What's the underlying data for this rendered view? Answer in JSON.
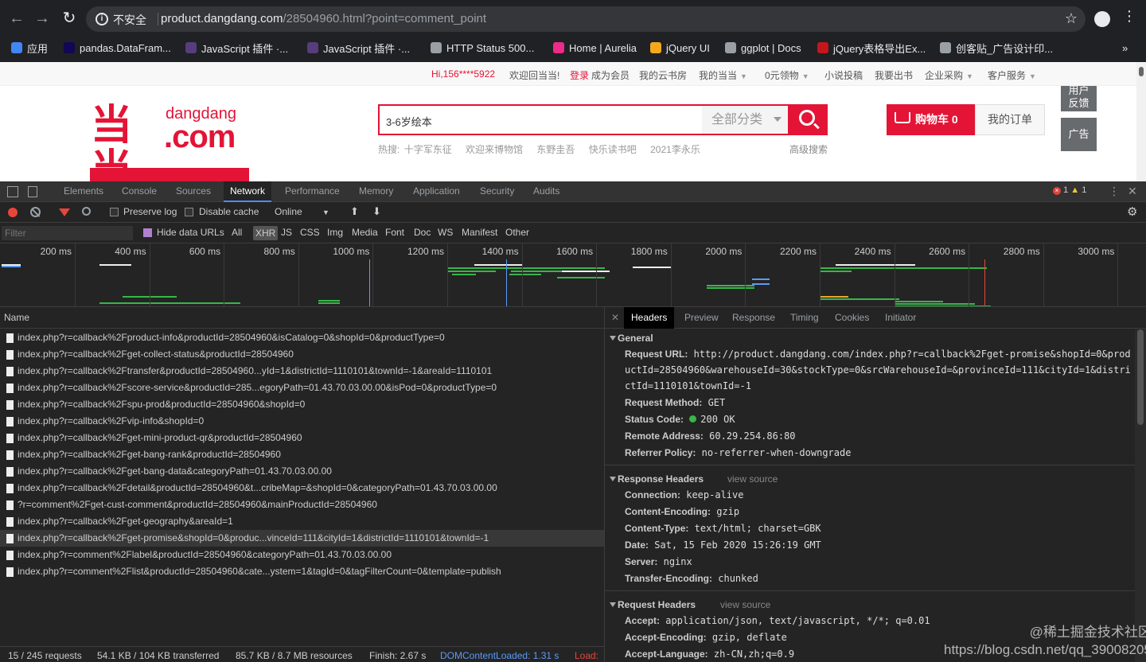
{
  "browser": {
    "insecure_label": "不安全",
    "url_host": "product.dangdang.com",
    "url_rest": "/28504960.html?point=comment_point",
    "bookmarks": [
      {
        "label": "应用",
        "icon": "apps-grid-icon",
        "color": "#4285f4"
      },
      {
        "label": "pandas.DataFram...",
        "icon": "pandas-icon",
        "color": "#130654"
      },
      {
        "label": "JavaScript 插件 ·...",
        "icon": "bootstrap-icon",
        "color": "#563d7c"
      },
      {
        "label": "JavaScript 插件 ·...",
        "icon": "bootstrap-icon",
        "color": "#563d7c"
      },
      {
        "label": "HTTP Status 500...",
        "icon": "globe-icon",
        "color": "#9aa0a6"
      },
      {
        "label": "Home | Aurelia",
        "icon": "aurelia-icon",
        "color": "#ed2b88"
      },
      {
        "label": "jQuery UI",
        "icon": "jquery-ui-icon",
        "color": "#f7a71c"
      },
      {
        "label": "ggplot | Docs",
        "icon": "globe-icon",
        "color": "#9aa0a6"
      },
      {
        "label": "jQuery表格导出Ex...",
        "icon": "record-icon",
        "color": "#c4161c"
      },
      {
        "label": "创客贴_广告设计印...",
        "icon": "globe-icon",
        "color": "#9aa0a6"
      }
    ],
    "more": "»"
  },
  "site": {
    "topbar": {
      "greeting": "Hi,156****5922",
      "welcome": "欢迎回当当!",
      "login": "登录",
      "member": "成为会员",
      "links": [
        "我的云书房",
        "我的当当",
        "0元领物",
        "小说投稿",
        "我要出书",
        "企业采购",
        "客户服务"
      ]
    },
    "logo": {
      "mark": "当当",
      "line1": "dangdang",
      "line2": ".com"
    },
    "search": {
      "value": "3-6岁绘本",
      "category": "全部分类"
    },
    "hot_label": "热搜:",
    "hot": [
      "十字军东征",
      "欢迎来博物馆",
      "东野圭吾",
      "快乐读书吧",
      "2021李永乐"
    ],
    "advanced": "高级搜索",
    "cart": "购物车 0",
    "orders": "我的订单",
    "side": {
      "feedback": "用户反馈",
      "ad": "广告"
    }
  },
  "devtools": {
    "tabs": [
      "Elements",
      "Console",
      "Sources",
      "Network",
      "Performance",
      "Memory",
      "Application",
      "Security",
      "Audits"
    ],
    "active_tab": "Network",
    "errors": "1",
    "warnings": "1",
    "toolbar": {
      "preserve_log": "Preserve log",
      "disable_cache": "Disable cache",
      "throttle": "Online"
    },
    "filter_placeholder": "Filter",
    "hide_data_urls": "Hide data URLs",
    "types": [
      "All",
      "XHR",
      "JS",
      "CSS",
      "Img",
      "Media",
      "Font",
      "Doc",
      "WS",
      "Manifest",
      "Other"
    ],
    "selected_type": "XHR",
    "timeline": {
      "ticks": [
        "200 ms",
        "400 ms",
        "600 ms",
        "800 ms",
        "1000 ms",
        "1200 ms",
        "1400 ms",
        "1600 ms",
        "1800 ms",
        "2000 ms",
        "2200 ms",
        "2400 ms",
        "2600 ms",
        "2800 ms",
        "3000 ms"
      ]
    },
    "name_header": "Name",
    "requests": [
      "index.php?r=callback%2Fproduct-info&productId=28504960&isCatalog=0&shopId=0&productType=0",
      "index.php?r=callback%2Fget-collect-status&productId=28504960",
      "index.php?r=callback%2Ftransfer&productId=28504960...yId=1&districtId=1110101&townId=-1&areaId=1110101",
      "index.php?r=callback%2Fscore-service&productId=285...egoryPath=01.43.70.03.00.00&isPod=0&productType=0",
      "index.php?r=callback%2Fspu-prod&productId=28504960&shopId=0",
      "index.php?r=callback%2Fvip-info&shopId=0",
      "index.php?r=callback%2Fget-mini-product-qr&productId=28504960",
      "index.php?r=callback%2Fget-bang-rank&productId=28504960",
      "index.php?r=callback%2Fget-bang-data&categoryPath=01.43.70.03.00.00",
      "index.php?r=callback%2Fdetail&productId=28504960&t...cribeMap=&shopId=0&categoryPath=01.43.70.03.00.00",
      "?r=comment%2Fget-cust-comment&productId=28504960&mainProductId=28504960",
      "index.php?r=callback%2Fget-geography&areaId=1",
      "index.php?r=callback%2Fget-promise&shopId=0&produc...vinceId=111&cityId=1&districtId=1110101&townId=-1",
      "index.php?r=comment%2Flabel&productId=28504960&categoryPath=01.43.70.03.00.00",
      "index.php?r=comment%2Flist&productId=28504960&cate...ystem=1&tagId=0&tagFilterCount=0&template=publish"
    ],
    "selected_request": 12,
    "status": {
      "requests": "15 / 245 requests",
      "transferred": "54.1 KB / 104 KB transferred",
      "resources": "85.7 KB / 8.7 MB resources",
      "finish": "Finish: 2.67 s",
      "dcl": "DOMContentLoaded: 1.31 s",
      "load": "Load:"
    },
    "detail_tabs": [
      "Headers",
      "Preview",
      "Response",
      "Timing",
      "Cookies",
      "Initiator"
    ],
    "active_detail_tab": "Headers",
    "general": {
      "title": "General",
      "rows": [
        {
          "k": "Request URL:",
          "v": "http://product.dangdang.com/index.php?r=callback%2Fget-promise&shopId=0&productId=28504960&warehouseId=30&stockType=0&srcWarehouseId=&provinceId=111&cityId=1&districtId=1110101&townId=-1"
        },
        {
          "k": "Request Method:",
          "v": "GET"
        },
        {
          "k": "Status Code:",
          "v": "200 OK"
        },
        {
          "k": "Remote Address:",
          "v": "60.29.254.86:80"
        },
        {
          "k": "Referrer Policy:",
          "v": "no-referrer-when-downgrade"
        }
      ]
    },
    "response_headers": {
      "title": "Response Headers",
      "view_source": "view source",
      "rows": [
        {
          "k": "Connection:",
          "v": "keep-alive"
        },
        {
          "k": "Content-Encoding:",
          "v": "gzip"
        },
        {
          "k": "Content-Type:",
          "v": "text/html; charset=GBK"
        },
        {
          "k": "Date:",
          "v": "Sat, 15 Feb 2020 15:26:19 GMT"
        },
        {
          "k": "Server:",
          "v": "nginx"
        },
        {
          "k": "Transfer-Encoding:",
          "v": "chunked"
        }
      ]
    },
    "request_headers": {
      "title": "Request Headers",
      "view_source": "view source",
      "rows": [
        {
          "k": "Accept:",
          "v": "application/json, text/javascript, */*; q=0.01"
        },
        {
          "k": "Accept-Encoding:",
          "v": "gzip, deflate"
        },
        {
          "k": "Accept-Language:",
          "v": "zh-CN,zh;q=0.9"
        }
      ]
    }
  },
  "watermark": {
    "line1": "@稀土掘金技术社区",
    "line2": "https://blog.csdn.net/qq_39008205"
  }
}
